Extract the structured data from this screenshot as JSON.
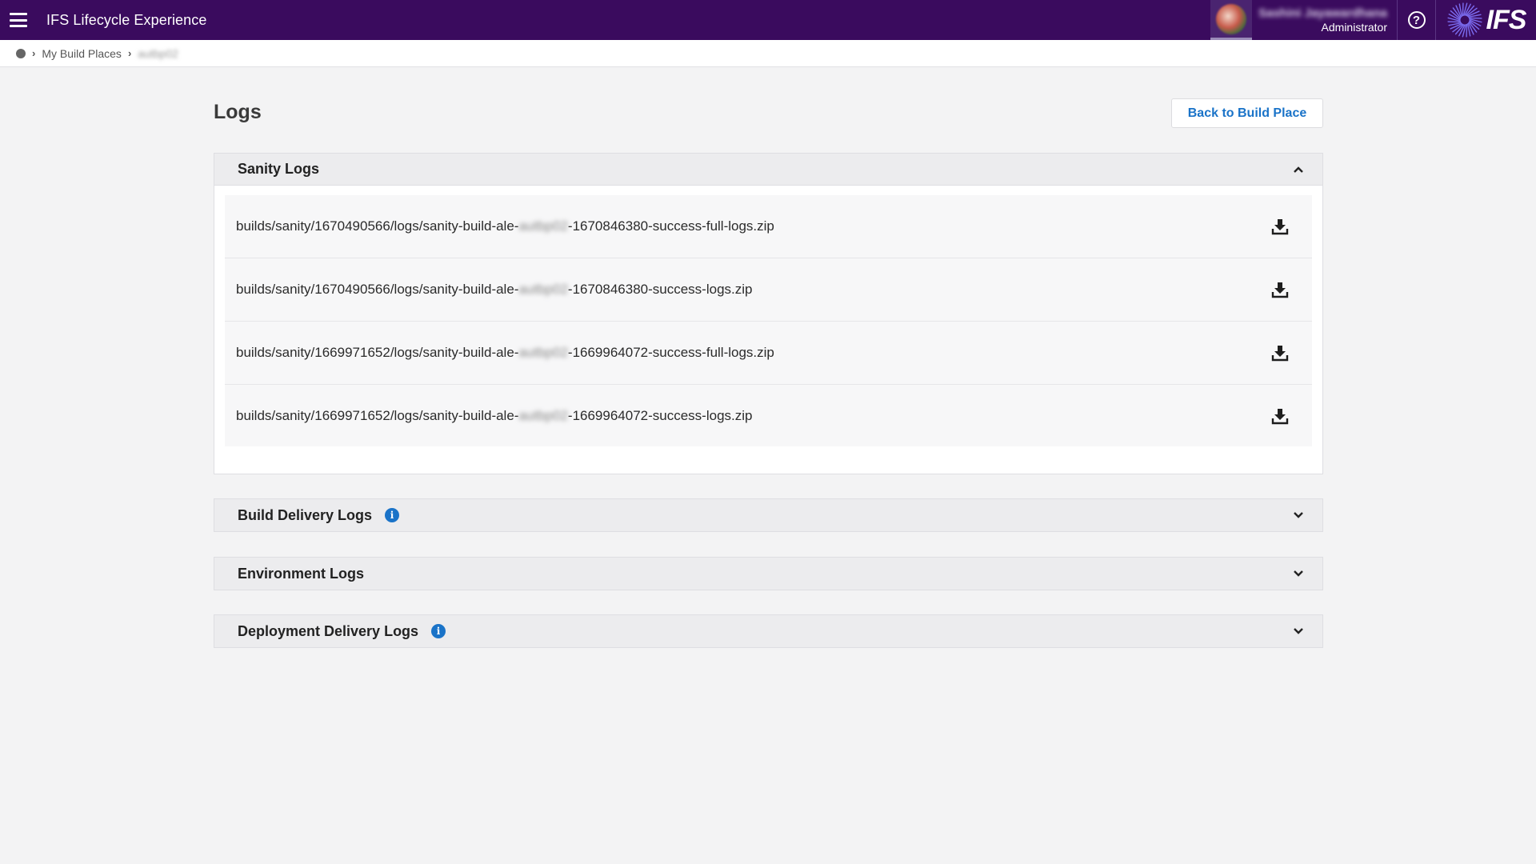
{
  "topbar": {
    "app_title": "IFS Lifecycle Experience",
    "user_name": "Sashini Jayawardhana",
    "user_role": "Administrator",
    "help_symbol": "?",
    "logo_text": "IFS",
    "icons": [
      "hamburger-icon",
      "avatar",
      "help-icon",
      "ifs-logo"
    ]
  },
  "breadcrumb": {
    "items": [
      "My Build Places",
      "autbp02"
    ]
  },
  "page": {
    "title": "Logs",
    "back_button": "Back to Build Place"
  },
  "panels": {
    "sanity": {
      "title": "Sanity Logs",
      "expanded": true,
      "logs": [
        {
          "prefix": "builds/sanity/1670490566/logs/sanity-build-ale-",
          "redacted": "autbp02",
          "suffix": "-1670846380-success-full-logs.zip"
        },
        {
          "prefix": "builds/sanity/1670490566/logs/sanity-build-ale-",
          "redacted": "autbp02",
          "suffix": "-1670846380-success-logs.zip"
        },
        {
          "prefix": "builds/sanity/1669971652/logs/sanity-build-ale-",
          "redacted": "autbp02",
          "suffix": "-1669964072-success-full-logs.zip"
        },
        {
          "prefix": "builds/sanity/1669971652/logs/sanity-build-ale-",
          "redacted": "autbp02",
          "suffix": "-1669964072-success-logs.zip"
        }
      ]
    },
    "build_delivery": {
      "title": "Build Delivery Logs",
      "expanded": false,
      "info": "i"
    },
    "environment": {
      "title": "Environment Logs",
      "expanded": false
    },
    "deployment_delivery": {
      "title": "Deployment Delivery Logs",
      "expanded": false,
      "info": "i"
    }
  },
  "colors": {
    "topbar": "#3a0b5e",
    "accent": "#1a73c8",
    "background": "#f3f3f4"
  }
}
